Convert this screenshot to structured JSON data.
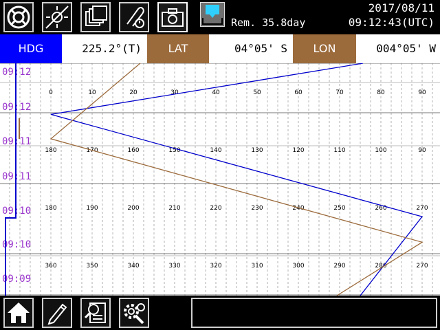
{
  "header": {
    "remaining": "Rem. 35.8day",
    "date": "2017/08/11",
    "time": "09:12:43(UTC)"
  },
  "status": {
    "hdg_label": "HDG",
    "hdg_value": "225.2°(T)",
    "lat_label": "LAT",
    "lat_value": "04°05' S",
    "lon_label": "LON",
    "lon_value": "004°05' W"
  },
  "toolbar_icons": [
    "lifebuoy-icon",
    "sun-dial-icon",
    "layers-icon",
    "clip-clock-icon",
    "camera-icon",
    "sd-card-download-icon"
  ],
  "bottom_icons": [
    "home-icon",
    "pencil-icon",
    "search-document-icon",
    "gear-wrench-icon"
  ],
  "message": "",
  "colors": {
    "heading_series": "#0000cc",
    "position_series": "#9c6b3c",
    "time_labels": "#9933cc",
    "hdg_accent": "#0000ff",
    "latlon_accent": "#9c6b3c"
  },
  "chart_data": {
    "type": "line",
    "bands": [
      {
        "ticks": [
          "0",
          "10",
          "20",
          "30",
          "40",
          "50",
          "60",
          "70",
          "80",
          "90"
        ]
      },
      {
        "ticks": [
          "180",
          "170",
          "160",
          "150",
          "140",
          "130",
          "120",
          "110",
          "100",
          "90"
        ]
      },
      {
        "ticks": [
          "180",
          "190",
          "200",
          "210",
          "220",
          "230",
          "240",
          "250",
          "260",
          "270"
        ]
      },
      {
        "ticks": [
          "360",
          "350",
          "340",
          "330",
          "320",
          "310",
          "300",
          "290",
          "280",
          "270"
        ]
      }
    ],
    "time_labels": [
      "09:12",
      "09:12",
      "09:11",
      "09:11",
      "09:10",
      "09:10",
      "09:09"
    ],
    "series": [
      {
        "points": [
          [
            227,
            0
          ],
          [
            0,
            0.22
          ],
          [
            270,
            0.66
          ],
          [
            225,
            1.0
          ]
        ]
      },
      {
        "points": [
          [
            65,
            0
          ],
          [
            0,
            0.325
          ],
          [
            270,
            0.77
          ],
          [
            208,
            1.0
          ]
        ]
      }
    ]
  }
}
